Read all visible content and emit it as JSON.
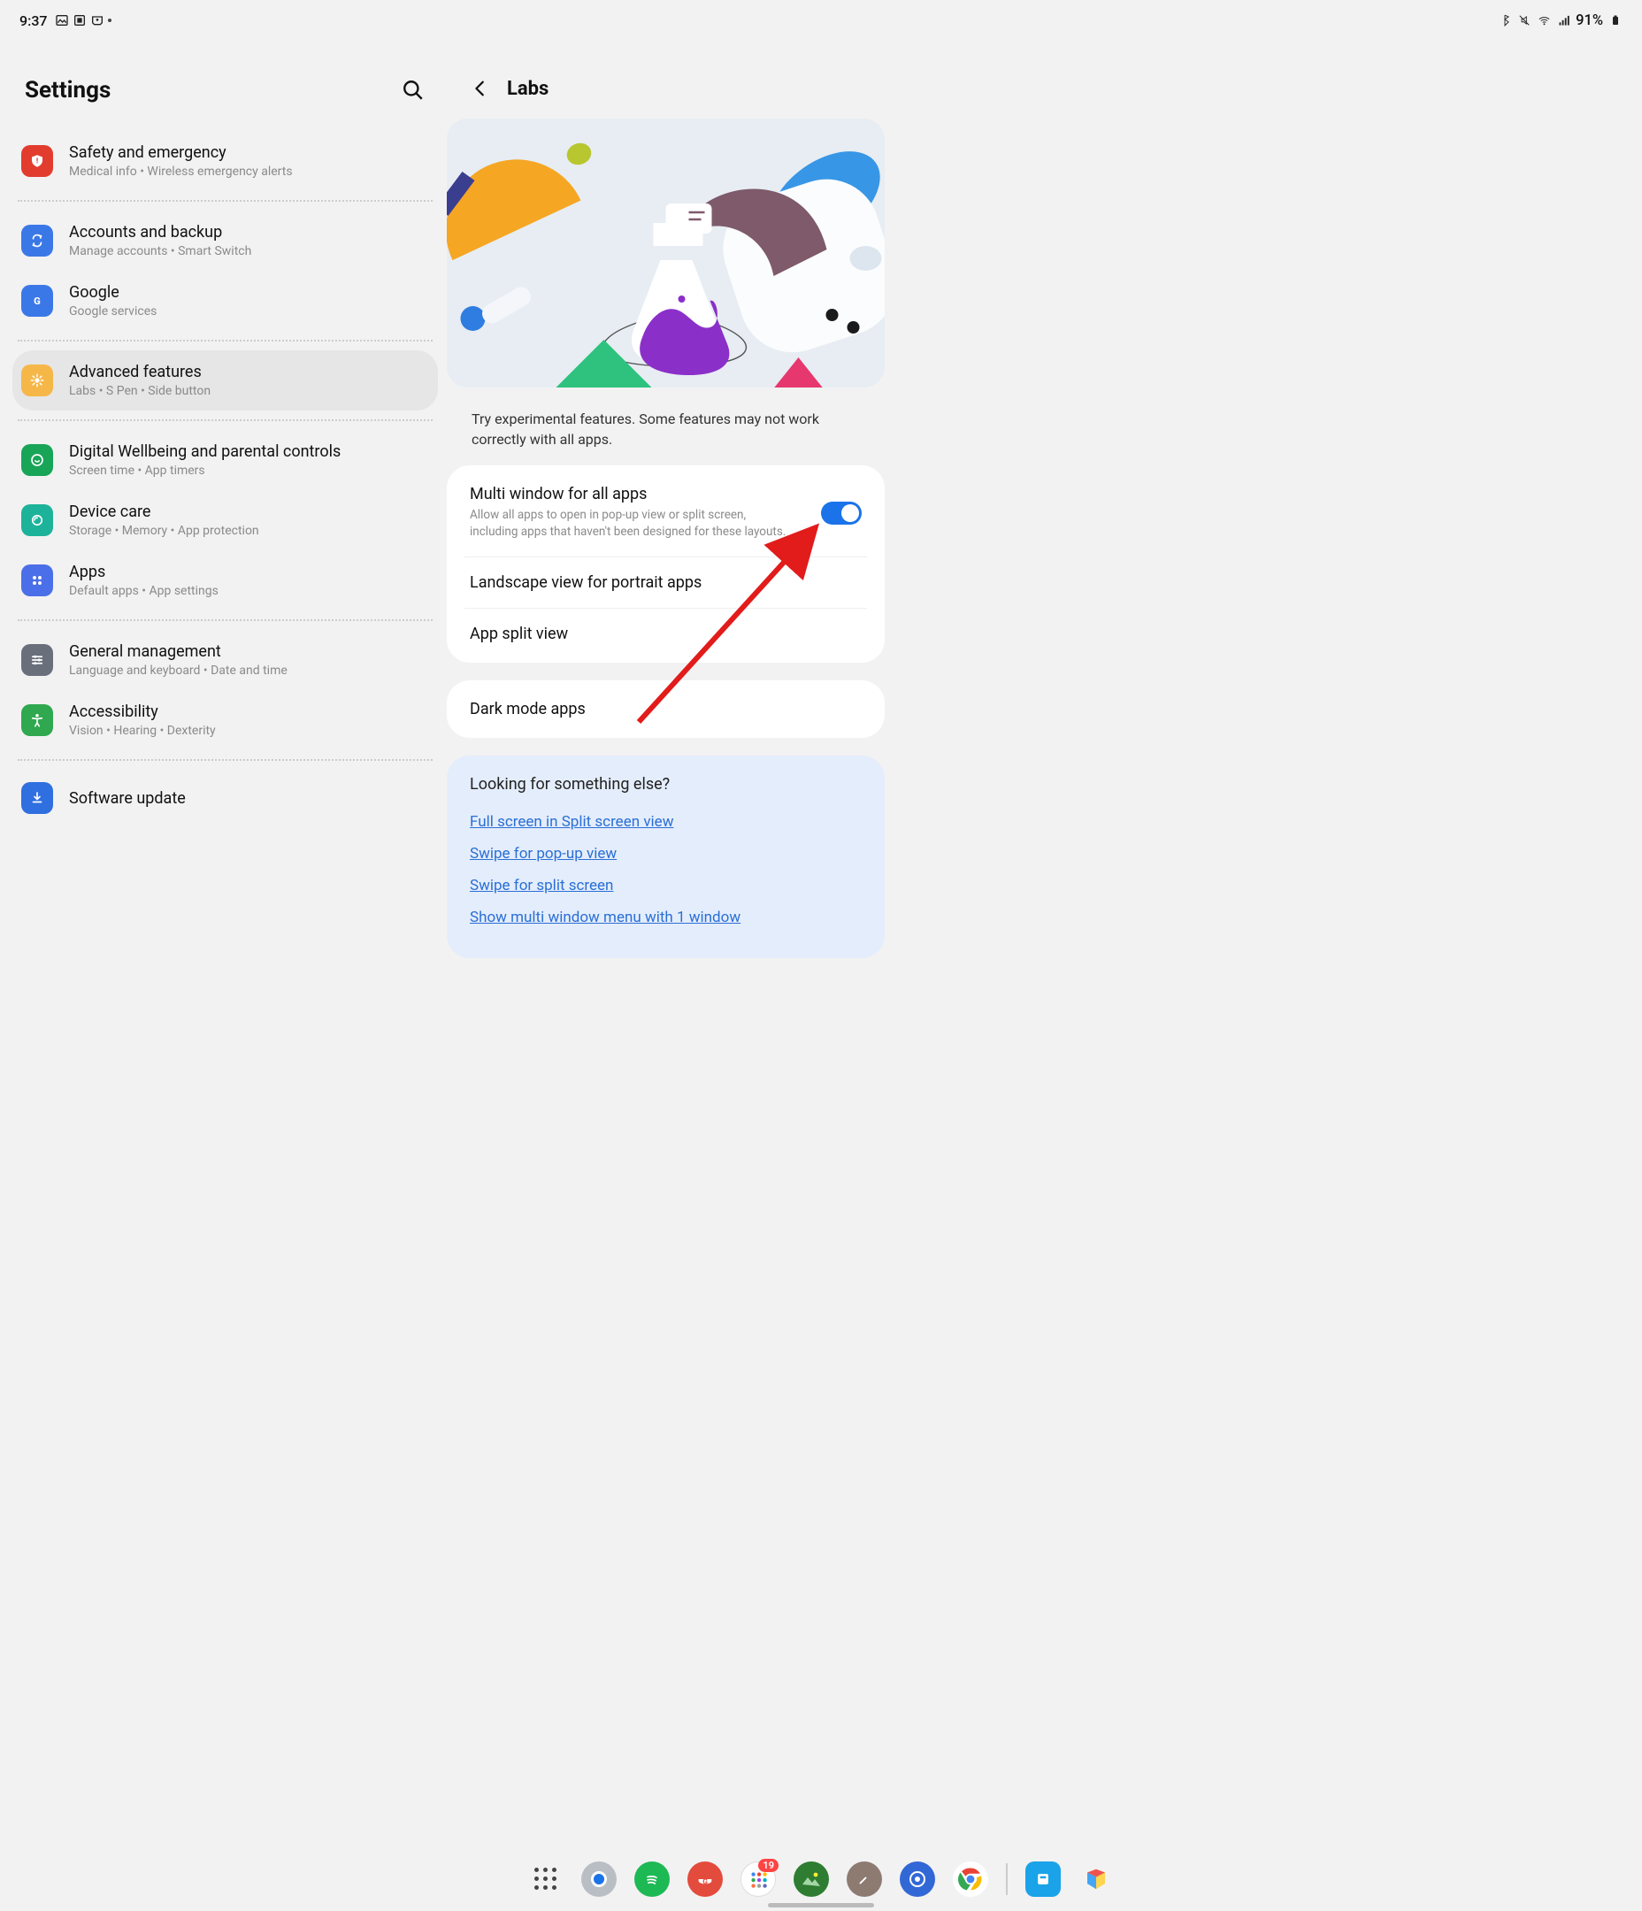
{
  "statusBar": {
    "time": "9:37",
    "battery": "91%"
  },
  "leftPane": {
    "title": "Settings",
    "groups": [
      {
        "items": [
          {
            "key": "safety",
            "title": "Safety and emergency",
            "sub": "Medical info  •  Wireless emergency alerts",
            "color": "#e23c2f"
          }
        ]
      },
      {
        "items": [
          {
            "key": "accounts",
            "title": "Accounts and backup",
            "sub": "Manage accounts  •  Smart Switch",
            "color": "#3b78e7"
          },
          {
            "key": "google",
            "title": "Google",
            "sub": "Google services",
            "color": "#3b78e7"
          }
        ]
      },
      {
        "items": [
          {
            "key": "advanced",
            "title": "Advanced features",
            "sub": "Labs  •  S Pen  •  Side button",
            "color": "#f6b749",
            "selected": true
          }
        ]
      },
      {
        "items": [
          {
            "key": "wellbeing",
            "title": "Digital Wellbeing and parental controls",
            "sub": "Screen time  •  App timers",
            "color": "#18a558"
          },
          {
            "key": "devicecare",
            "title": "Device care",
            "sub": "Storage  •  Memory  •  App protection",
            "color": "#1cb39a"
          },
          {
            "key": "apps",
            "title": "Apps",
            "sub": "Default apps  •  App settings",
            "color": "#4b6fe8"
          }
        ]
      },
      {
        "items": [
          {
            "key": "general",
            "title": "General management",
            "sub": "Language and keyboard  •  Date and time",
            "color": "#69707c"
          },
          {
            "key": "accessibility",
            "title": "Accessibility",
            "sub": "Vision  •  Hearing  •  Dexterity",
            "color": "#2fa84f"
          }
        ]
      },
      {
        "items": [
          {
            "key": "software",
            "title": "Software update",
            "sub": "",
            "color": "#2f6fe0"
          }
        ]
      }
    ]
  },
  "rightPane": {
    "title": "Labs",
    "description": "Try experimental features. Some features may not work correctly with all apps.",
    "card1": [
      {
        "title": "Multi window for all apps",
        "sub": "Allow all apps to open in pop-up view or split screen, including apps that haven't been designed for these layouts.",
        "toggle": true
      },
      {
        "title": "Landscape view for portrait apps"
      },
      {
        "title": "App split view"
      }
    ],
    "card2": [
      {
        "title": "Dark mode apps"
      }
    ],
    "lfse": {
      "heading": "Looking for something else?",
      "links": [
        "Full screen in Split screen view",
        "Swipe for pop-up view",
        "Swipe for split screen",
        "Show multi window menu with 1 window"
      ]
    }
  },
  "dock": {
    "badge": "19"
  }
}
